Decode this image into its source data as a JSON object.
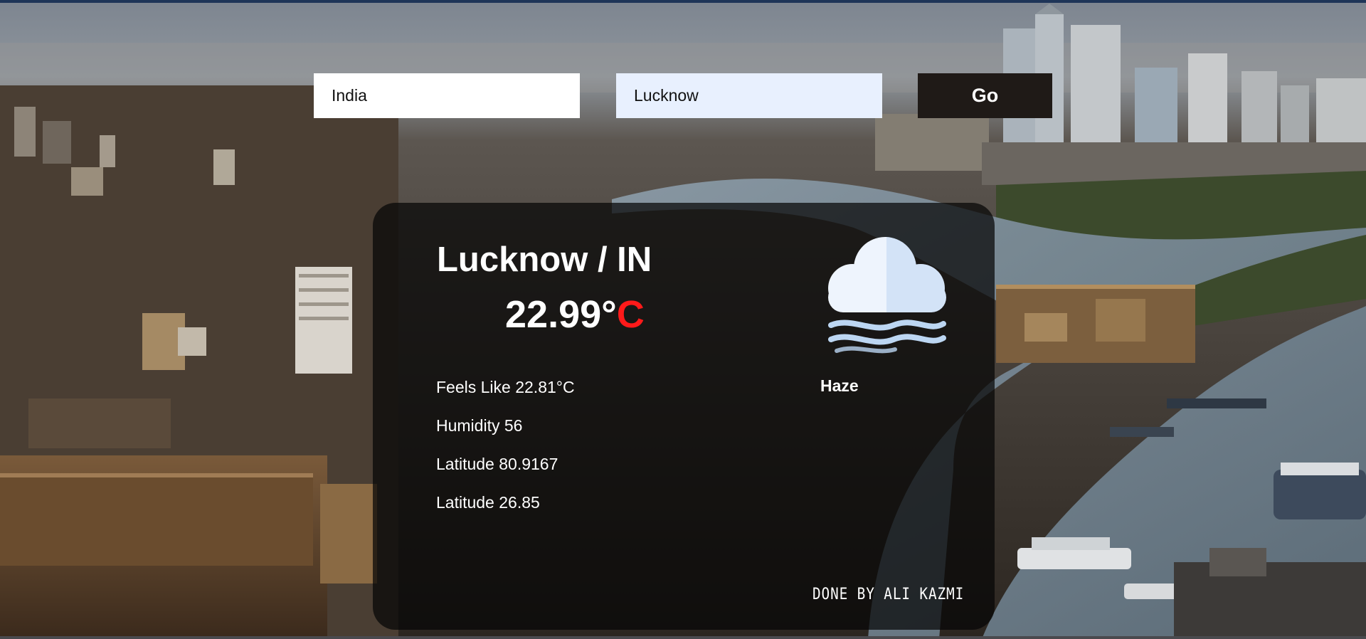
{
  "search": {
    "country_value": "India",
    "city_value": "Lucknow",
    "go_label": "Go"
  },
  "weather": {
    "location": "Lucknow / IN",
    "temperature": "22.99°",
    "temperature_unit": "C",
    "feels_like": "Feels Like 22.81°C",
    "humidity": "Humidity 56",
    "longitude_line": "Latitude 80.9167",
    "latitude_line": "Latitude 26.85",
    "condition": "Haze",
    "icon": "haze-cloud-icon"
  },
  "footer": {
    "credit": "DONE BY ALI KAZMI"
  },
  "colors": {
    "temp_unit": "#ff1a1a",
    "card_bg": "rgba(5,5,5,0.72)",
    "go_bg": "#1f1a17",
    "city_field_bg": "#e8f0fe"
  }
}
